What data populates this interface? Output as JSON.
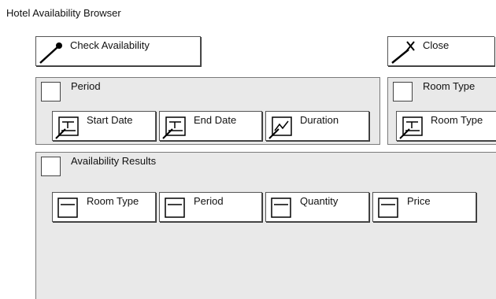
{
  "window": {
    "title": "Hotel Availability Browser"
  },
  "toolbar": {
    "check_availability_label": "Check Availability",
    "close_label": "Close"
  },
  "period": {
    "title": "Period",
    "fields": [
      {
        "label": "Start Date",
        "icon": "text-field-icon"
      },
      {
        "label": "End Date",
        "icon": "text-field-icon"
      },
      {
        "label": "Duration",
        "icon": "numeric-field-icon"
      }
    ]
  },
  "room_type": {
    "title": "Room Type",
    "fields": [
      {
        "label": "Room Type",
        "icon": "text-field-icon"
      }
    ]
  },
  "results": {
    "title": "Availability Results",
    "columns": [
      {
        "label": "Room Type",
        "icon": "column-icon"
      },
      {
        "label": "Period",
        "icon": "column-icon"
      },
      {
        "label": "Quantity",
        "icon": "column-icon"
      },
      {
        "label": "Price",
        "icon": "column-icon"
      }
    ]
  }
}
